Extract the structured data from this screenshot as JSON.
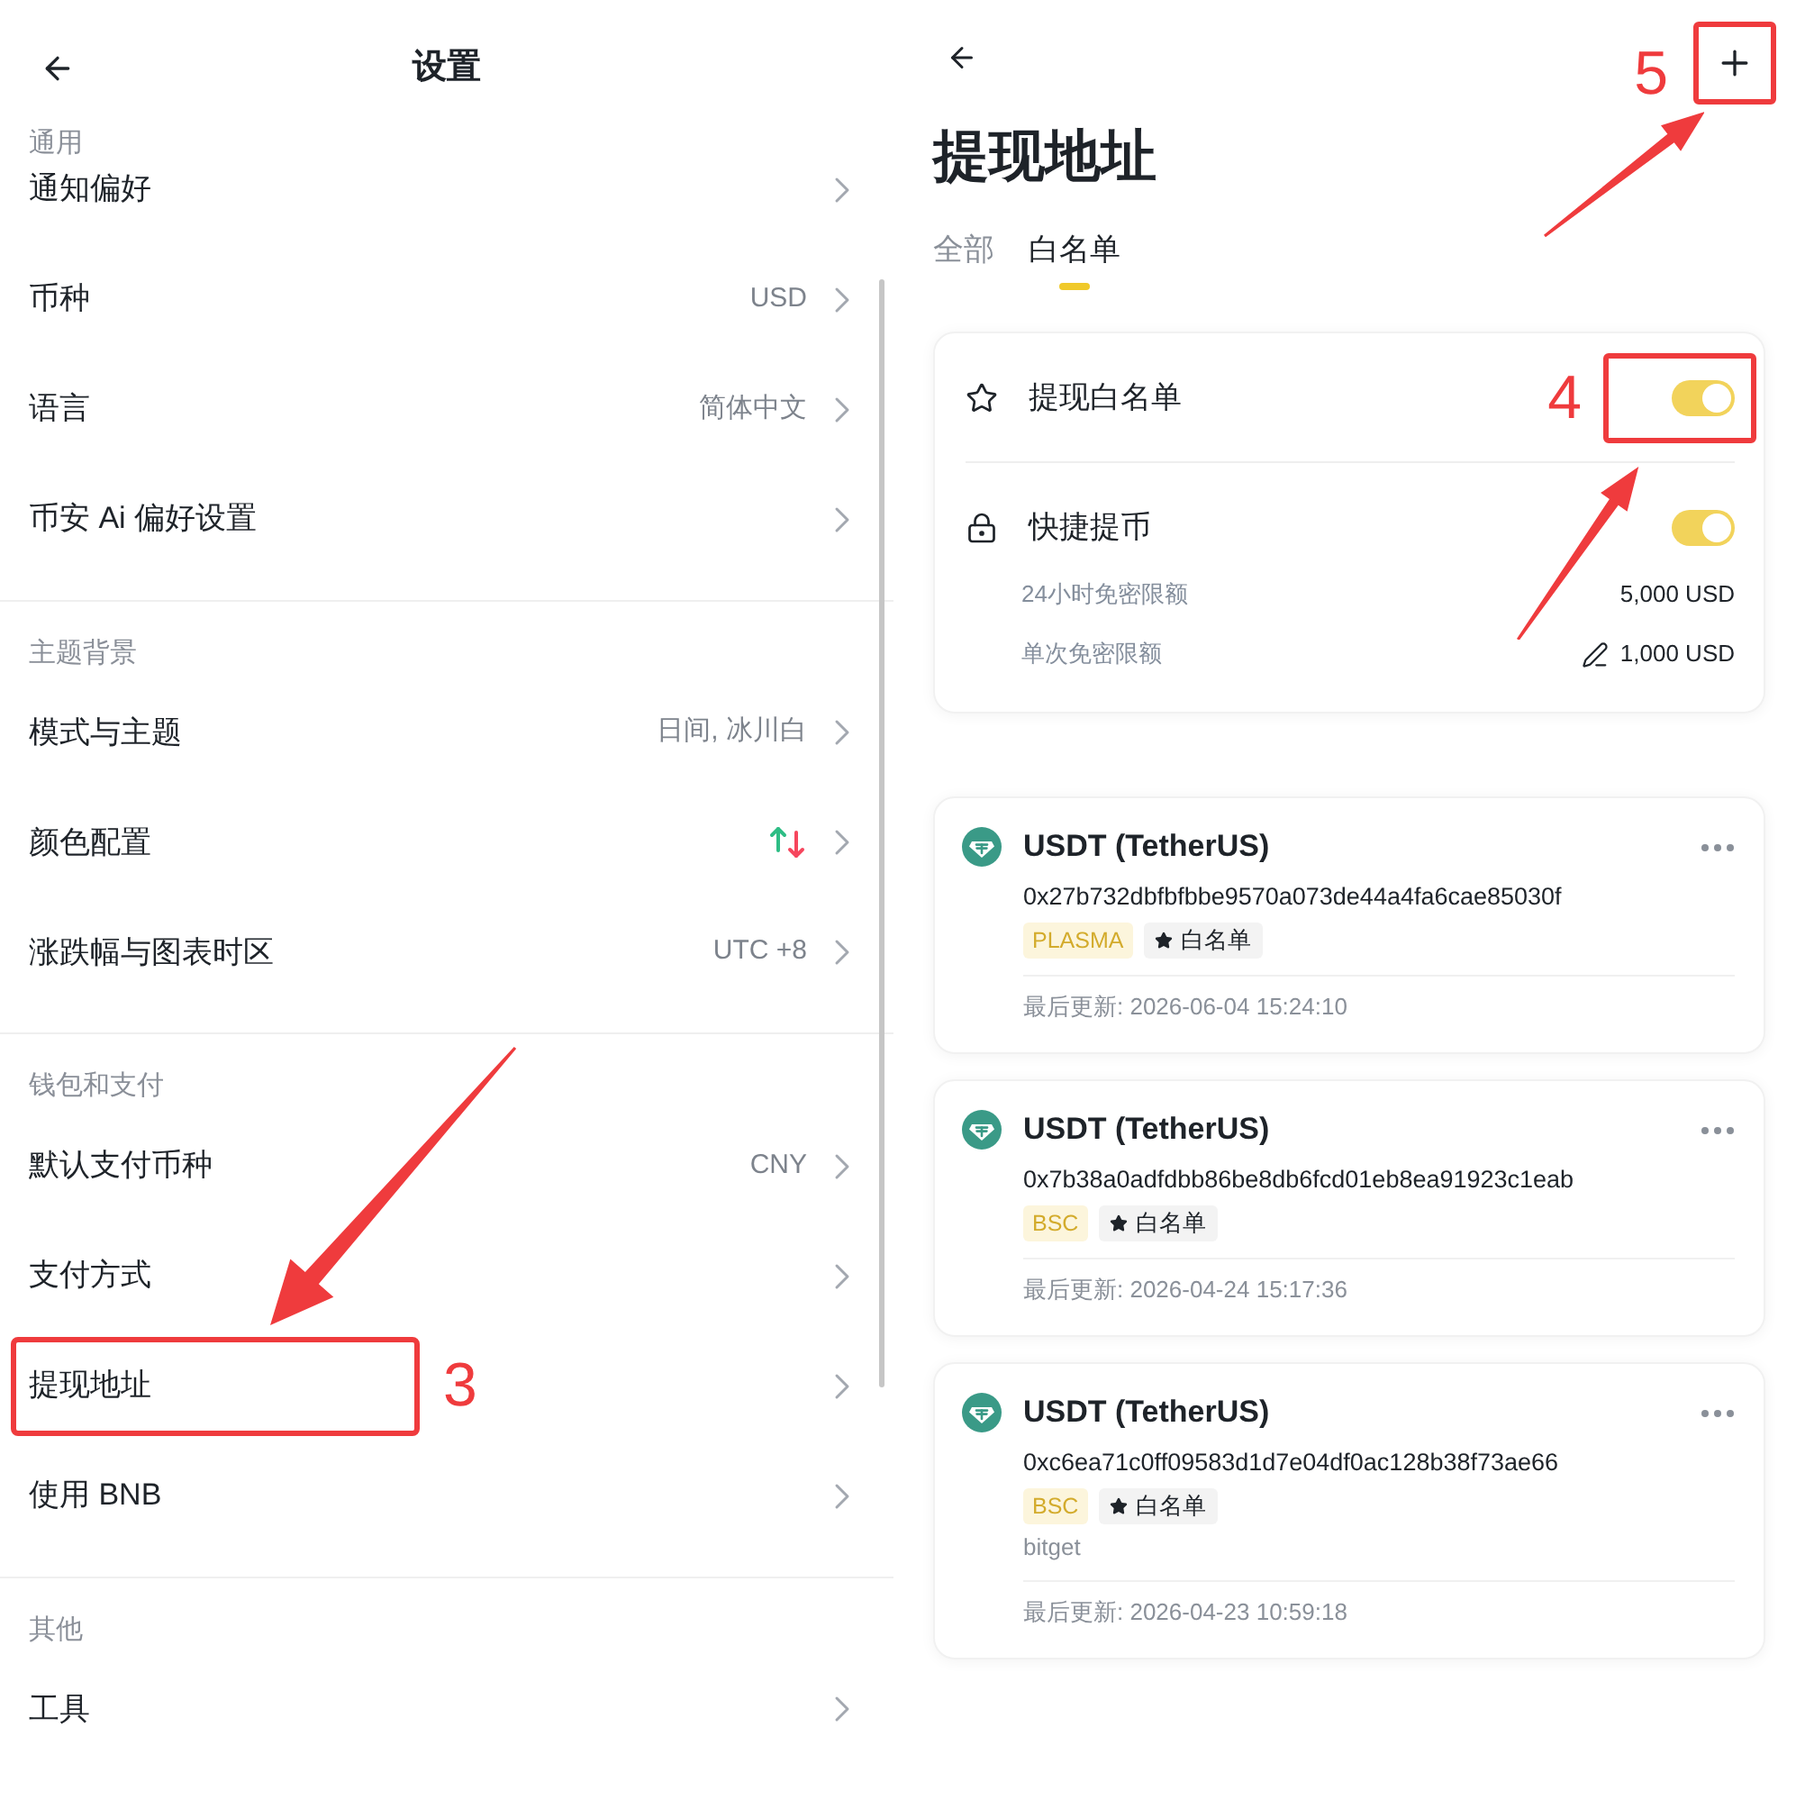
{
  "settings": {
    "title": "设置",
    "sections": [
      {
        "header": "通用",
        "items": [
          {
            "kind": "plain",
            "label": "通知偏好"
          },
          {
            "kind": "value",
            "label": "币种",
            "value": "USD"
          },
          {
            "kind": "value",
            "label": "语言",
            "value": "简体中文"
          },
          {
            "kind": "plain",
            "label": "币安 Ai 偏好设置"
          }
        ]
      },
      {
        "header": "主题背景",
        "items": [
          {
            "kind": "value",
            "label": "模式与主题",
            "value": "日间, 冰川白"
          },
          {
            "kind": "colors",
            "label": "颜色配置"
          },
          {
            "kind": "value",
            "label": "涨跌幅与图表时区",
            "value": "UTC +8"
          }
        ]
      },
      {
        "header": "钱包和支付",
        "items": [
          {
            "kind": "value",
            "label": "默认支付币种",
            "value": "CNY"
          },
          {
            "kind": "plain",
            "label": "支付方式"
          },
          {
            "kind": "plain",
            "label": "提现地址",
            "annotation": "3"
          },
          {
            "kind": "plain",
            "label": "使用 BNB"
          }
        ]
      },
      {
        "header": "其他",
        "items": [
          {
            "kind": "plain",
            "label": "工具"
          }
        ]
      }
    ]
  },
  "withdrawal_addresses": {
    "add_button": {
      "annotation": "5"
    },
    "title": "提现地址",
    "tabs": [
      {
        "label": "全部",
        "selected": false
      },
      {
        "label": "白名单",
        "selected": true
      }
    ],
    "security": {
      "toggles": [
        {
          "kind": "whitelist",
          "label": "提现白名单",
          "on": true,
          "annotation": "4"
        },
        {
          "kind": "quick",
          "label": "快捷提币",
          "on": true
        }
      ],
      "limits": [
        {
          "label": "24小时免密限额",
          "value": "5,000 USD",
          "editable": false
        },
        {
          "label": "单次免密限额",
          "value": "1,000 USD",
          "editable": true
        }
      ]
    },
    "addresses": [
      {
        "name": "USDT (TetherUS)",
        "address": "0x27b732dbfbfbbe9570a073de44a4fa6cae85030f",
        "network": "PLASMA",
        "whitelist_tag": "白名单",
        "updated": "最后更新: 2026-06-04 15:24:10"
      },
      {
        "name": "USDT (TetherUS)",
        "address": "0x7b38a0adfdbb86be8db6fcd01eb8ea91923c1eab",
        "network": "BSC",
        "whitelist_tag": "白名单",
        "updated": "最后更新: 2026-04-24 15:17:36"
      },
      {
        "name": "USDT (TetherUS)",
        "address": "0xc6ea71c0ff09583d1d7e04df0ac128b38f73ae66",
        "network": "BSC",
        "whitelist_tag": "白名单",
        "note": "bitget",
        "updated": "最后更新: 2026-04-23 10:59:18"
      }
    ]
  }
}
